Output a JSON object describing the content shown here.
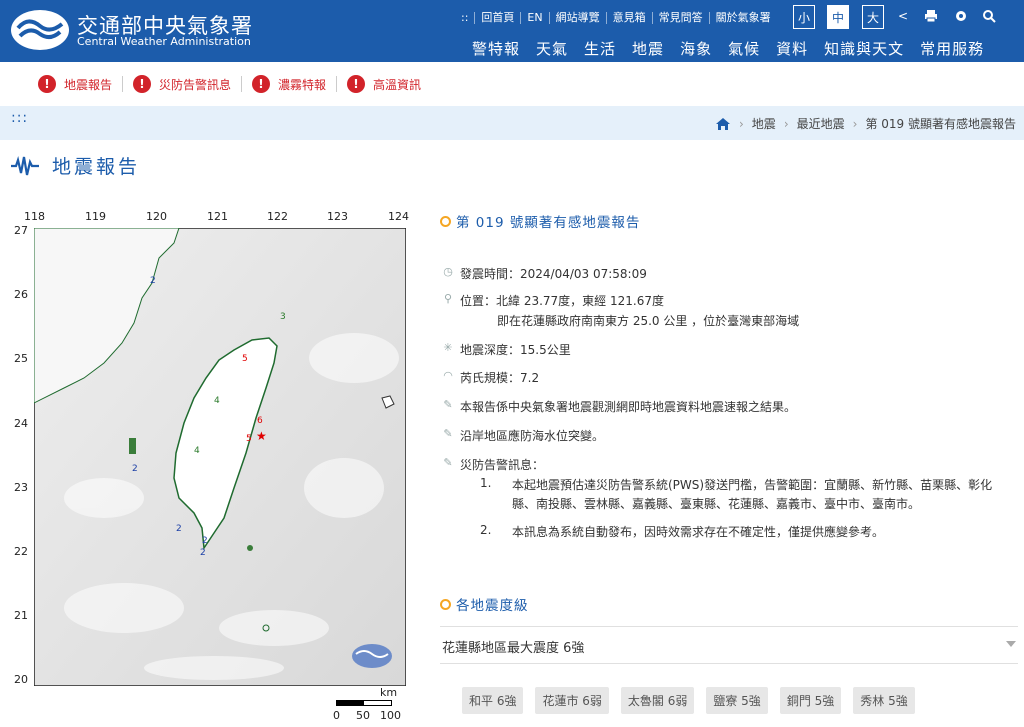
{
  "header": {
    "title": "交通部中央氣象署",
    "subtitle": "Central Weather Administration",
    "utility": [
      "::",
      "回首頁",
      "EN",
      "網站導覽",
      "意見箱",
      "常見問答",
      "關於氣象署"
    ],
    "font_sizes": [
      "小",
      "中",
      "大"
    ],
    "font_size_selected": "中",
    "nav": [
      "警特報",
      "天氣",
      "生活",
      "地震",
      "海象",
      "氣候",
      "資料",
      "知識與天文",
      "常用服務"
    ],
    "brand_color": "#1c5cab"
  },
  "alerts": [
    {
      "label": "地震報告",
      "icon": "exclamation-icon"
    },
    {
      "label": "災防告警訊息",
      "icon": "exclamation-icon"
    },
    {
      "label": "濃霧特報",
      "icon": "exclamation-icon"
    },
    {
      "label": "高溫資訊",
      "icon": "exclamation-icon"
    }
  ],
  "breadcrumb": {
    "dots": ":::",
    "items": [
      "地震",
      "最近地震",
      "第 019 號顯著有感地震報告"
    ]
  },
  "page_title": "地震報告",
  "map": {
    "lon_ticks": [
      "118",
      "119",
      "120",
      "121",
      "122",
      "123",
      "124"
    ],
    "lat_ticks": [
      "27",
      "26",
      "25",
      "24",
      "23",
      "22",
      "21",
      "20"
    ],
    "scale_unit": "km",
    "scale_labels": [
      "0",
      "50",
      "100"
    ],
    "map_intensity_labels": [
      "3",
      "2",
      "2",
      "2",
      "2",
      "2",
      "5",
      "6",
      "5",
      "4",
      "4"
    ]
  },
  "report": {
    "title": "第 019 號顯著有感地震報告",
    "time": "發震時間：2024/04/03 07:58:09",
    "location_1": "位置：北緯 23.77度，東經 121.67度",
    "location_2": "即在花蓮縣政府南南東方 25.0 公里 ，位於臺灣東部海域",
    "depth": "地震深度：15.5公里",
    "magnitude": "芮氏規模：7.2",
    "note": "本報告係中央氣象署地震觀測網即時地震資料地震速報之結果。",
    "coast": "沿岸地區應防海水位突變。",
    "pws_title": "災防告警訊息：",
    "pws_items": [
      {
        "num": "1.",
        "text": "本起地震預估達災防告警系統(PWS)發送門檻，告警範圍：宜蘭縣、新竹縣、苗栗縣、彰化縣、南投縣、雲林縣、嘉義縣、臺東縣、花蓮縣、嘉義市、臺中市、臺南市。"
      },
      {
        "num": "2.",
        "text": "本訊息為系統自動發布，因時效需求存在不確定性，僅提供應變參考。"
      }
    ]
  },
  "intensity": {
    "section_title": "各地震度級",
    "region": "花蓮縣地區最大震度 6強",
    "stations": [
      "和平 6強",
      "花蓮市 6弱",
      "太魯閣 6弱",
      "鹽寮 5強",
      "銅門 5強",
      "秀林 5強"
    ]
  }
}
